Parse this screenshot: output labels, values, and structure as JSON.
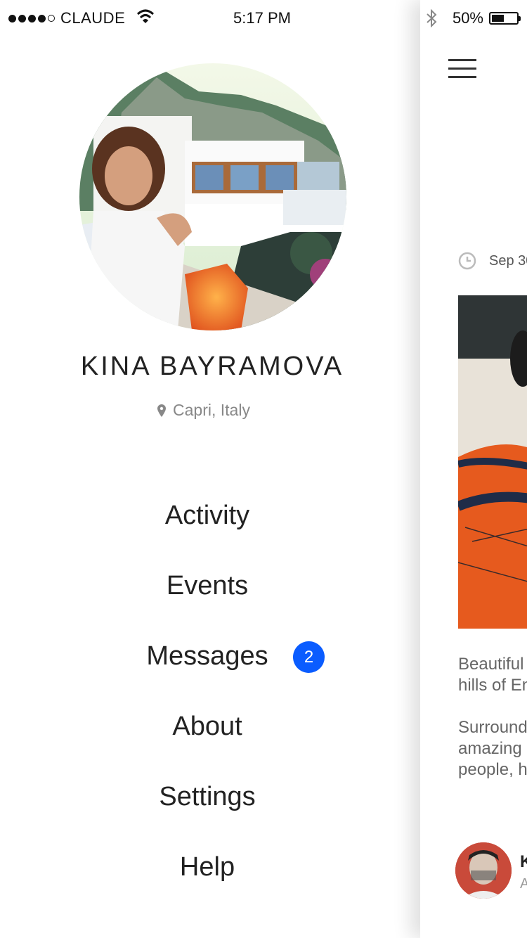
{
  "status_bar": {
    "carrier": "CLAUDE",
    "time": "5:17 PM",
    "battery_percent": "50%",
    "signal_strength": 4,
    "battery_level": 0.5
  },
  "profile": {
    "name": "KINA BAYRAMOVA",
    "location": "Capri, Italy",
    "photo_icon": "profile-photo"
  },
  "menu": {
    "items": [
      {
        "label": "Activity"
      },
      {
        "label": "Events"
      },
      {
        "label": "Messages",
        "badge": "2"
      },
      {
        "label": "About"
      },
      {
        "label": "Settings"
      },
      {
        "label": "Help"
      }
    ]
  },
  "content_peek": {
    "date": "Sep 30",
    "paragraphs": [
      "Beautiful",
      "hills of En",
      "Surround",
      "amazing",
      "people, h"
    ],
    "author_initial": "K",
    "author_sub": "A"
  },
  "colors": {
    "badge": "#0a5cff",
    "text": "#222222",
    "muted": "#888888"
  }
}
